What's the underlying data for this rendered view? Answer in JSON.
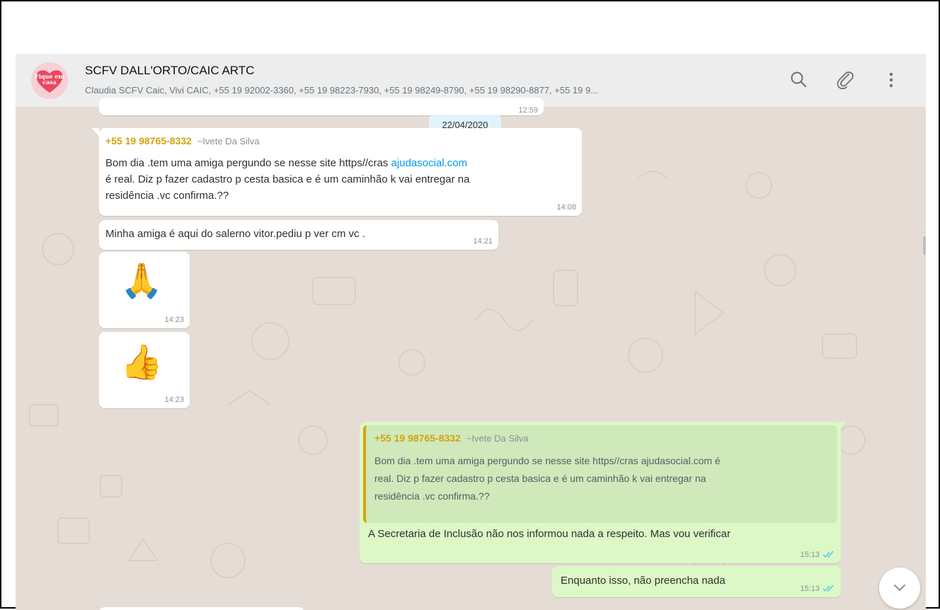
{
  "header": {
    "avatar_text": "Fique em casa",
    "title": "SCFV DALL'ORTO/CAIC ARTC",
    "subtitle": "Claudia SCFV Caic, Vivi CAIC, +55 19 92002-3360, +55 19 98223-7930, +55 19 98249-8790, +55 19 98290-8877, +55 19 9...",
    "icons": [
      "search-icon",
      "attach-icon",
      "menu-icon"
    ]
  },
  "date_chip": "22/04/2020",
  "messages": {
    "top_partial_time": "12:59",
    "m1": {
      "sender": "+55 19 98765-8332",
      "pushname": "~Ivete Da Silva",
      "line1_pre": "Bom dia .tem uma amiga pergundo se nesse site https//cras ",
      "line1_link": "ajudasocial.com",
      "line2": "é real. Diz p fazer cadastro p cesta basica e é um caminhão k vai entregar na",
      "line3": "residência .vc confirma.??",
      "time": "14:08"
    },
    "m2": {
      "text": "Minha amiga é aqui do salerno vitor.pediu p ver cm vc .",
      "time": "14:21"
    },
    "m3": {
      "emoji": "🙏",
      "time": "14:23"
    },
    "m4": {
      "emoji": "👍",
      "time": "14:23"
    },
    "m5": {
      "quote_sender": "+55 19 98765-8332",
      "quote_pushname": "~Ivete Da Silva",
      "quote_line1": "Bom dia .tem uma amiga pergundo se nesse site https//cras ajudasocial.com é",
      "quote_line2": "real. Diz p fazer cadastro p cesta basica e é um caminhão k vai entregar na",
      "quote_line3": "residência .vc confirma.??",
      "text": "A Secretaria de Inclusão não nos informou nada a respeito. Mas vou verificar",
      "time": "15:13"
    },
    "m6": {
      "text": "Enquanto isso, não preencha nada",
      "time": "15:13"
    }
  },
  "colors": {
    "chat_bg": "#e5ddd5",
    "incoming": "#ffffff",
    "outgoing": "#dcf8c6",
    "sender_name": "#d3a30f",
    "link": "#039be5",
    "read_ticks": "#4fc3f7",
    "date_chip": "#e1f3fb"
  }
}
